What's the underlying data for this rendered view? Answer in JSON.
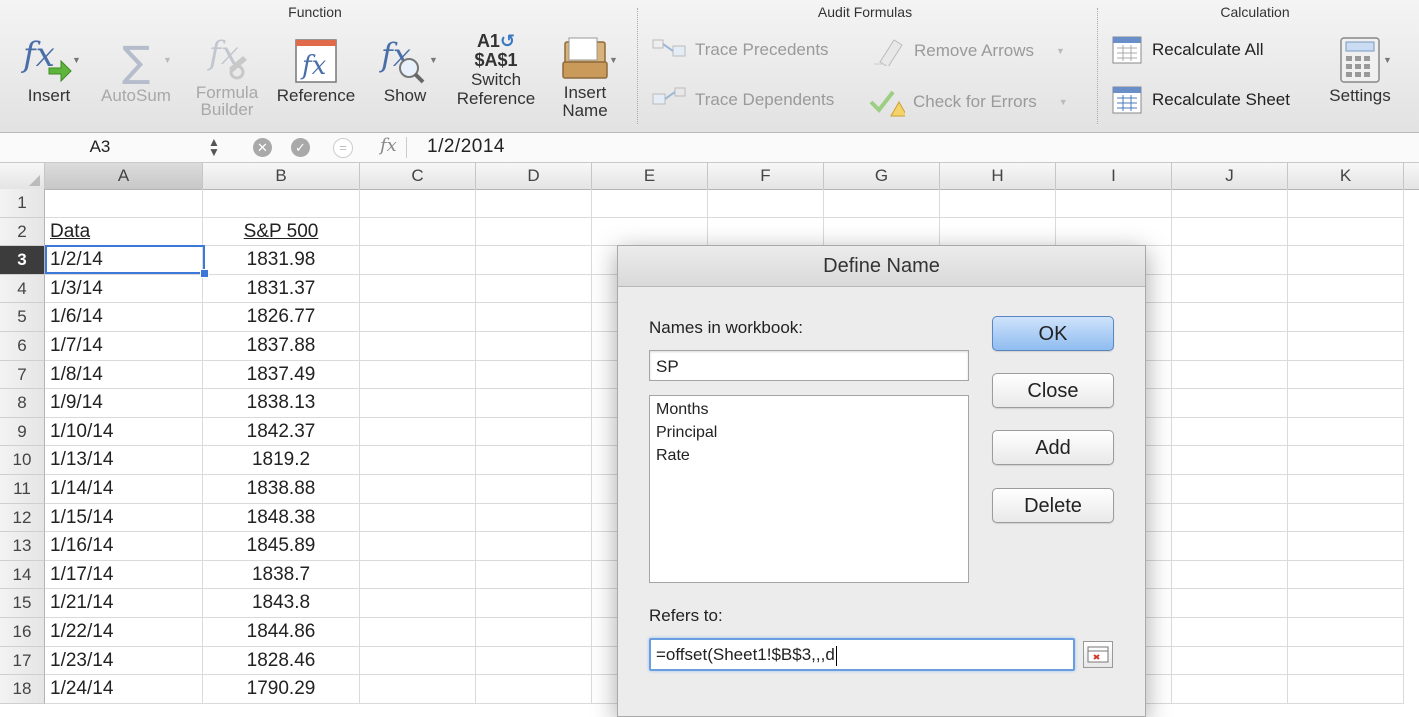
{
  "ribbon": {
    "groups": {
      "function": "Function",
      "audit": "Audit Formulas",
      "calculation": "Calculation"
    },
    "function_buttons": {
      "insert": "Insert",
      "autosum": "AutoSum",
      "formula_builder_1": "Formula",
      "formula_builder_2": "Builder",
      "reference": "Reference",
      "show": "Show",
      "switch_top": "A1",
      "switch_mid": "$A$1",
      "switch_1": "Switch",
      "switch_2": "Reference",
      "insert_name_1": "Insert",
      "insert_name_2": "Name"
    },
    "audit": {
      "trace_precedents": "Trace Precedents",
      "trace_dependents": "Trace Dependents",
      "remove_arrows": "Remove Arrows",
      "check_errors": "Check for Errors"
    },
    "calculation": {
      "recalc_all": "Recalculate All",
      "recalc_sheet": "Recalculate Sheet",
      "settings": "Settings"
    }
  },
  "formula_bar": {
    "name_box": "A3",
    "fx": "fx",
    "value": "1/2/2014"
  },
  "grid": {
    "columns": [
      "A",
      "B",
      "C",
      "D",
      "E",
      "F",
      "G",
      "H",
      "I",
      "J",
      "K"
    ],
    "selected_column": "A",
    "selected_row": "3",
    "rows": [
      {
        "n": "1",
        "a": "",
        "b": ""
      },
      {
        "n": "2",
        "a": "Data",
        "b": "S&P 500"
      },
      {
        "n": "3",
        "a": "1/2/14",
        "b": "1831.98"
      },
      {
        "n": "4",
        "a": "1/3/14",
        "b": "1831.37"
      },
      {
        "n": "5",
        "a": "1/6/14",
        "b": "1826.77"
      },
      {
        "n": "6",
        "a": "1/7/14",
        "b": "1837.88"
      },
      {
        "n": "7",
        "a": "1/8/14",
        "b": "1837.49"
      },
      {
        "n": "8",
        "a": "1/9/14",
        "b": "1838.13"
      },
      {
        "n": "9",
        "a": "1/10/14",
        "b": "1842.37"
      },
      {
        "n": "10",
        "a": "1/13/14",
        "b": "1819.2"
      },
      {
        "n": "11",
        "a": "1/14/14",
        "b": "1838.88"
      },
      {
        "n": "12",
        "a": "1/15/14",
        "b": "1848.38"
      },
      {
        "n": "13",
        "a": "1/16/14",
        "b": "1845.89"
      },
      {
        "n": "14",
        "a": "1/17/14",
        "b": "1838.7"
      },
      {
        "n": "15",
        "a": "1/21/14",
        "b": "1843.8"
      },
      {
        "n": "16",
        "a": "1/22/14",
        "b": "1844.86"
      },
      {
        "n": "17",
        "a": "1/23/14",
        "b": "1828.46"
      },
      {
        "n": "18",
        "a": "1/24/14",
        "b": "1790.29"
      }
    ]
  },
  "dialog": {
    "title": "Define Name",
    "names_label": "Names in workbook:",
    "name_value": "SP",
    "names_list": [
      "Months",
      "Principal",
      "Rate"
    ],
    "refers_label": "Refers to:",
    "refers_value": "=offset(Sheet1!$B$3,,,d",
    "buttons": {
      "ok": "OK",
      "close": "Close",
      "add": "Add",
      "delete": "Delete"
    }
  },
  "colors": {
    "selection": "#3c78d8",
    "default_button": "#8fbcf0"
  }
}
